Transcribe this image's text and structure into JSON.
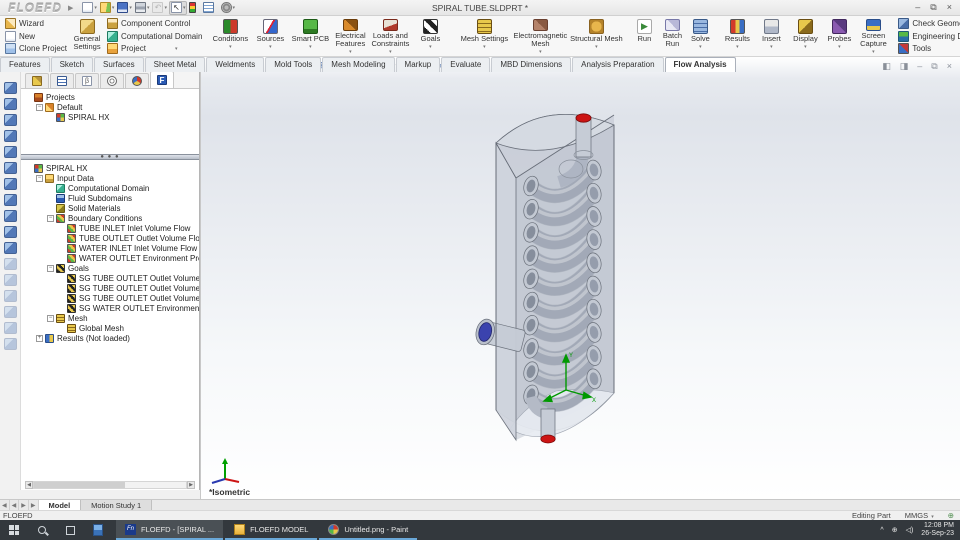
{
  "window": {
    "logo": "FLOEFD",
    "title": "SPIRAL TUBE.SLDPRT *",
    "minimize": "–",
    "restore": "⧉",
    "close": "×"
  },
  "qat": {
    "icons": [
      {
        "name": "new-document-icon",
        "cls": "ic-new",
        "dd": true
      },
      {
        "name": "open-icon",
        "cls": "ic-open",
        "dd": true
      },
      {
        "name": "save-icon",
        "cls": "ic-save",
        "dd": true
      },
      {
        "name": "print-icon",
        "cls": "ic-print",
        "dd": true
      },
      {
        "name": "undo-icon",
        "cls": "ic-undo",
        "glyph": "↶",
        "dd": true
      },
      {
        "name": "select-icon",
        "cls": "ic-select",
        "glyph": "↖",
        "dd": true,
        "pressed": true
      },
      {
        "name": "traffic-light-icon",
        "cls": "ic-traffic",
        "dd": false
      },
      {
        "name": "grid-icon",
        "cls": "ic-grid",
        "dd": false
      },
      {
        "name": "options-gear-icon",
        "cls": "ic-gear",
        "dd": true
      }
    ]
  },
  "ribbon": {
    "project_group": {
      "wizard": "Wizard",
      "new": "New",
      "clone": "Clone Project",
      "general_settings": "General Settings",
      "component_control": "Component Control",
      "computational_domain": "Computational Domain",
      "project": "Project"
    },
    "flow_tools": [
      {
        "label": "Conditions",
        "cls": "ic-conditions",
        "dd": true
      },
      {
        "label": "Sources",
        "cls": "ic-sources",
        "dd": true
      },
      {
        "label": "Smart PCB",
        "cls": "ic-smartpcb",
        "dd": true
      },
      {
        "label": "Electrical Features",
        "cls": "ic-elec",
        "dd": true
      },
      {
        "label": "Loads and Constraints",
        "cls": "ic-loads",
        "dd": true
      },
      {
        "label": "Goals",
        "cls": "ic-goals",
        "dd": true
      }
    ],
    "mesh_tools": [
      {
        "label": "Mesh Settings",
        "cls": "ic-meshset",
        "dd": true
      },
      {
        "label": "Electromagnetic Mesh",
        "cls": "ic-emmesh",
        "dd": true
      },
      {
        "label": "Structural Mesh",
        "cls": "ic-structmesh",
        "dd": true
      }
    ],
    "run_tools": [
      {
        "label": "Run",
        "cls": "ic-run",
        "glyph": "▶",
        "dd": false
      },
      {
        "label": "Batch Run",
        "cls": "ic-batch",
        "dd": false
      },
      {
        "label": "Solve",
        "cls": "ic-solve",
        "dd": true
      }
    ],
    "results_tools": [
      {
        "label": "Results",
        "cls": "ic-results",
        "dd": true
      },
      {
        "label": "Insert",
        "cls": "ic-insert",
        "dd": true
      },
      {
        "label": "Display",
        "cls": "ic-display",
        "dd": true
      },
      {
        "label": "Probes",
        "cls": "ic-probes",
        "dd": true
      },
      {
        "label": "Screen Capture",
        "cls": "ic-capture",
        "dd": true
      }
    ],
    "right_tools": [
      {
        "label": "Check Geometry",
        "cls": "ic-checkgeo",
        "dd": false
      },
      {
        "label": "Engineering Database",
        "cls": "ic-engdb",
        "dd": false
      },
      {
        "label": "Tools",
        "cls": "ic-tools",
        "dd": true
      }
    ]
  },
  "command_tabs": [
    {
      "label": "Features",
      "state": ""
    },
    {
      "label": "Sketch",
      "state": ""
    },
    {
      "label": "Surfaces",
      "state": ""
    },
    {
      "label": "Sheet Metal",
      "state": ""
    },
    {
      "label": "Weldments",
      "state": ""
    },
    {
      "label": "Mold Tools",
      "state": ""
    },
    {
      "label": "Mesh Modeling",
      "state": ""
    },
    {
      "label": "Markup",
      "state": ""
    },
    {
      "label": "Evaluate",
      "state": ""
    },
    {
      "label": "MBD Dimensions",
      "state": ""
    },
    {
      "label": "Analysis Preparation",
      "state": ""
    },
    {
      "label": "Flow Analysis",
      "state": "active"
    }
  ],
  "hud": {
    "icons": [
      {
        "name": "zoom-to-fit-icon",
        "glyph": "⊕",
        "dd": false,
        "pressed": false
      },
      {
        "name": "zoom-to-area-icon",
        "glyph": "⊞",
        "dd": false,
        "pressed": false
      },
      {
        "name": "previous-view-icon",
        "glyph": "↶",
        "dd": false,
        "pressed": false
      },
      {
        "name": "section-view-icon",
        "glyph": "◫",
        "dd": false,
        "pressed": true
      },
      {
        "name": "view-orientation-icon",
        "glyph": "◧",
        "dd": true,
        "pressed": false
      },
      {
        "name": "display-style-icon",
        "glyph": "◨",
        "dd": true,
        "pressed": false
      },
      {
        "name": "hide-show-items-icon",
        "glyph": "◉",
        "dd": true,
        "pressed": false
      },
      {
        "name": "appearance-icon",
        "glyph": "◕",
        "dd": true,
        "pressed": false
      },
      {
        "name": "view-settings-icon",
        "glyph": "▭",
        "dd": true,
        "pressed": false
      }
    ]
  },
  "doc_controls": [
    "◧",
    "◨",
    "–",
    "⧉",
    "×"
  ],
  "left_toolbar": {
    "icon_count": 17,
    "dim_from": 11
  },
  "tree_tabs": [
    {
      "name": "featuremanager-tab",
      "cls": "tt-feature",
      "state": ""
    },
    {
      "name": "propertymanager-tab",
      "cls": "tt-table",
      "state": ""
    },
    {
      "name": "configurationmanager-tab",
      "cls": "tt-config",
      "glyph": "β",
      "state": ""
    },
    {
      "name": "dimxpertmanager-tab",
      "cls": "tt-dimxpert",
      "state": ""
    },
    {
      "name": "displaymanager-tab",
      "cls": "tt-display",
      "state": ""
    },
    {
      "name": "floefd-tab",
      "cls": "tt-floefd",
      "glyph": "F",
      "state": "active"
    }
  ],
  "project_tree": [
    {
      "label": "Projects",
      "level": 0,
      "exp": "none",
      "icon": "ic-projects"
    },
    {
      "label": "Default",
      "level": 1,
      "exp": "minus",
      "icon": "ic-defaultcfg"
    },
    {
      "label": "SPIRAL HX",
      "level": 2,
      "exp": "none",
      "icon": "ic-hxproj"
    }
  ],
  "analysis_tree": [
    {
      "label": "SPIRAL HX",
      "level": 0,
      "exp": "none",
      "icon": "ic-hxproj"
    },
    {
      "label": "Input Data",
      "level": 1,
      "exp": "minus",
      "icon": "ic-inputdata"
    },
    {
      "label": "Computational Domain",
      "level": 2,
      "exp": "none",
      "icon": "ic-domain2"
    },
    {
      "label": "Fluid Subdomains",
      "level": 2,
      "exp": "none",
      "icon": "ic-fluid"
    },
    {
      "label": "Solid Materials",
      "level": 2,
      "exp": "none",
      "icon": "ic-solid"
    },
    {
      "label": "Boundary Conditions",
      "level": 2,
      "exp": "minus",
      "icon": "ic-bc"
    },
    {
      "label": "TUBE INLET Inlet Volume Flow",
      "level": 3,
      "exp": "none",
      "icon": "ic-bc"
    },
    {
      "label": "TUBE OUTLET Outlet Volume Flow",
      "level": 3,
      "exp": "none",
      "icon": "ic-bc"
    },
    {
      "label": "WATER INLET Inlet Volume Flow",
      "level": 3,
      "exp": "none",
      "icon": "ic-bc"
    },
    {
      "label": "WATER OUTLET Environment Pressure",
      "level": 3,
      "exp": "none",
      "icon": "ic-bc"
    },
    {
      "label": "Goals",
      "level": 2,
      "exp": "minus",
      "icon": "ic-goalflag"
    },
    {
      "label": "SG TUBE OUTLET Outlet Volume Flow Static Pres",
      "level": 3,
      "exp": "none",
      "icon": "ic-goalflag"
    },
    {
      "label": "SG TUBE OUTLET Outlet Volume Flow Total Press",
      "level": 3,
      "exp": "none",
      "icon": "ic-goalflag"
    },
    {
      "label": "SG TUBE OUTLET Outlet Volume Flow Temperatu",
      "level": 3,
      "exp": "none",
      "icon": "ic-goalflag"
    },
    {
      "label": "SG WATER OUTLET Environment Pressure Tempe",
      "level": 3,
      "exp": "none",
      "icon": "ic-goalflag"
    },
    {
      "label": "Mesh",
      "level": 2,
      "exp": "minus",
      "icon": "ic-mesh2"
    },
    {
      "label": "Global Mesh",
      "level": 3,
      "exp": "none",
      "icon": "ic-mesh2"
    },
    {
      "label": "Results (Not loaded)",
      "level": 1,
      "exp": "plus",
      "icon": "ic-resultstree"
    }
  ],
  "viewport": {
    "view_label": "*Isometric",
    "triad": {
      "x": "X",
      "y": "Y",
      "z": "Z"
    }
  },
  "model_tabs": {
    "nav": [
      "◀",
      "◀",
      "▶",
      "▶"
    ],
    "tabs": [
      {
        "label": "Model",
        "state": "active"
      },
      {
        "label": "Motion Study 1",
        "state": ""
      }
    ]
  },
  "statusbar": {
    "app": "FLOEFD",
    "editing": "Editing Part",
    "units": "MMGS"
  },
  "taskbar": {
    "buttons": [
      {
        "label": "FLOEFD - [SPIRAL ...",
        "icls": "tb-floefd",
        "glyph": "Fn",
        "state": "active"
      },
      {
        "label": "FLOEFD MODEL",
        "icls": "tb-folder",
        "glyph": "",
        "state": ""
      },
      {
        "label": "Untitled.png - Paint",
        "icls": "tb-paint",
        "glyph": "",
        "state": ""
      }
    ],
    "tray": {
      "chevron": "^",
      "network": "⊕",
      "volume": "◁)",
      "time": "12:08 PM",
      "date": "26-Sep-23"
    }
  },
  "colors": {
    "accent_blue": "#6aa8d8",
    "cap_red": "#cc1414",
    "cap_blue": "#3b43ae",
    "triad_green": "#009900",
    "shell_gray": "#c9ced8",
    "edge_gray": "#676d78",
    "coil_gray": "#aeb5c3"
  }
}
